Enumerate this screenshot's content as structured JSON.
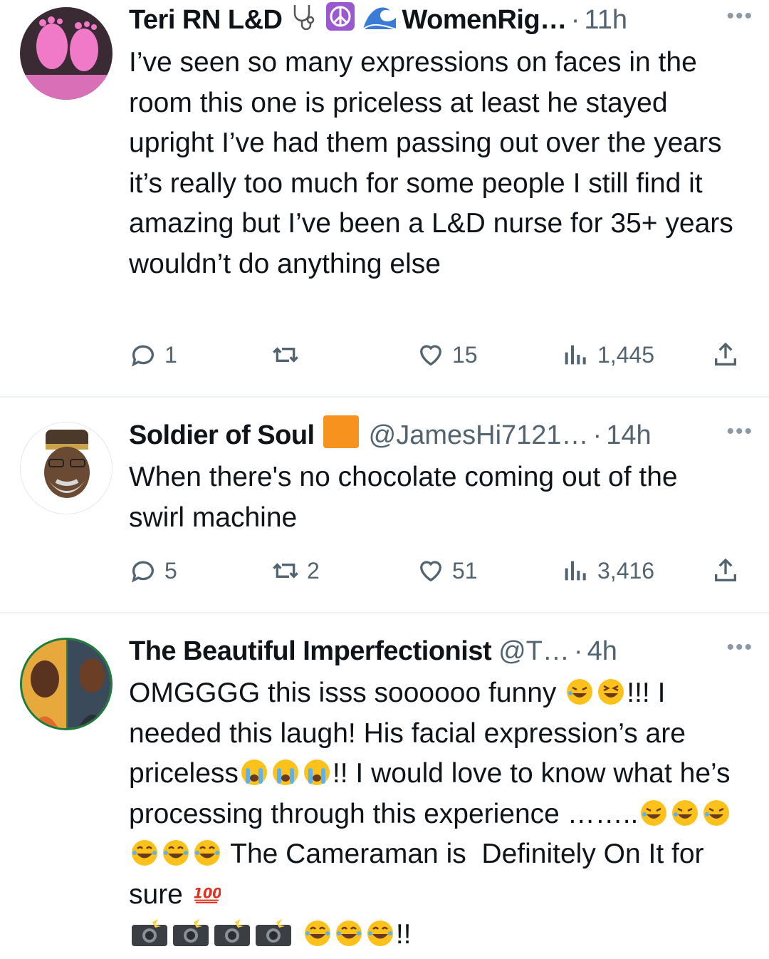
{
  "tweets": [
    {
      "display_name": "Teri RN L&D",
      "badges": [
        "stethoscope-icon",
        "peace-icon",
        "wave-icon"
      ],
      "handle": "WomenRig…",
      "dot": "·",
      "time": "11h",
      "text": "I’ve seen so many expressions on faces in the room this one is priceless at least he stayed upright I’ve had them passing out over the years it’s really too much for some people I still find it amazing but I’ve been a L&D nurse for 35+ years wouldn’t do anything else",
      "replies": "1",
      "retweets": "",
      "likes": "15",
      "views": "1,445"
    },
    {
      "display_name": "Soldier of Soul",
      "badges": [
        "orange-square-icon"
      ],
      "handle": "@JamesHi7121…",
      "dot": "·",
      "time": "14h",
      "text": "When there's no chocolate coming out of the swirl machine",
      "replies": "5",
      "retweets": "2",
      "likes": "51",
      "views": "3,416"
    },
    {
      "display_name": "The Beautiful Imperfectionist",
      "badges": [],
      "handle": "@T…",
      "dot": "·",
      "time": "4h",
      "text_parts": [
        "OMGGGG this isss soooooo funny ",
        "!!! I needed this laugh! His facial expression’s are priceless",
        "!! I would love to know what he’s processing through this experience ……..",
        " The Cameraman is  Definitely On It for sure ",
        "!!"
      ],
      "replies": "",
      "retweets": "",
      "likes": "",
      "views": ""
    }
  ],
  "icons": {
    "reply": "reply-icon",
    "retweet": "retweet-icon",
    "like": "heart-icon",
    "views": "views-icon",
    "share": "share-icon",
    "more": "more-icon"
  },
  "more_glyph": "•••",
  "colors": {
    "text": "#0f1419",
    "secondary": "#536471",
    "divider": "#eff3f4"
  }
}
